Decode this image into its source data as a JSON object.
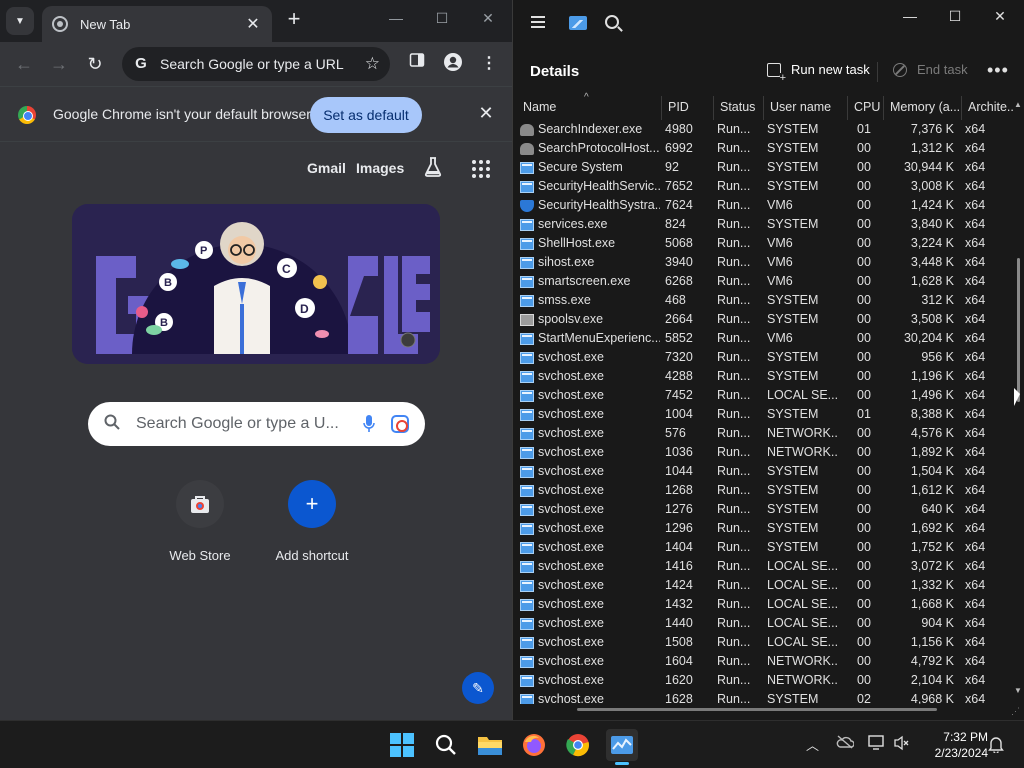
{
  "chrome": {
    "tab_title": "New Tab",
    "tab_close": "✕",
    "new_tab": "+",
    "window_min": "—",
    "window_max": "☐",
    "window_close": "✕",
    "omnibox_placeholder": "Search Google or type a URL",
    "omnibox_g": "G",
    "infobar_text": "Google Chrome isn't your default browser",
    "set_default_label": "Set as default",
    "infobar_close": "✕",
    "gmail_link": "Gmail",
    "images_link": "Images",
    "ntp_search_placeholder": "Search Google or type a U...",
    "shortcuts": [
      {
        "label": "Web Store"
      },
      {
        "label": "Add shortcut",
        "glyph": "+"
      }
    ],
    "edit_glyph": "✎"
  },
  "taskmanager": {
    "heading": "Details",
    "run_new_task": "Run new task",
    "end_task": "End task",
    "more": "•••",
    "window_min": "—",
    "window_max": "☐",
    "window_close": "✕",
    "columns": [
      "Name",
      "PID",
      "Status",
      "User name",
      "CPU",
      "Memory (a...",
      "Archite..."
    ],
    "rows": [
      {
        "icon": "search",
        "name": "SearchIndexer.exe",
        "pid": "4980",
        "status": "Run...",
        "user": "SYSTEM",
        "cpu": "01",
        "mem": "7,376 K",
        "arch": "x64"
      },
      {
        "icon": "search",
        "name": "SearchProtocolHost....",
        "pid": "6992",
        "status": "Run...",
        "user": "SYSTEM",
        "cpu": "00",
        "mem": "1,312 K",
        "arch": "x64"
      },
      {
        "icon": "exe",
        "name": "Secure System",
        "pid": "92",
        "status": "Run...",
        "user": "SYSTEM",
        "cpu": "00",
        "mem": "30,944 K",
        "arch": "x64"
      },
      {
        "icon": "exe",
        "name": "SecurityHealthServic...",
        "pid": "7652",
        "status": "Run...",
        "user": "SYSTEM",
        "cpu": "00",
        "mem": "3,008 K",
        "arch": "x64"
      },
      {
        "icon": "shield",
        "name": "SecurityHealthSystra...",
        "pid": "7624",
        "status": "Run...",
        "user": "VM6",
        "cpu": "00",
        "mem": "1,424 K",
        "arch": "x64"
      },
      {
        "icon": "exe",
        "name": "services.exe",
        "pid": "824",
        "status": "Run...",
        "user": "SYSTEM",
        "cpu": "00",
        "mem": "3,840 K",
        "arch": "x64"
      },
      {
        "icon": "exe",
        "name": "ShellHost.exe",
        "pid": "5068",
        "status": "Run...",
        "user": "VM6",
        "cpu": "00",
        "mem": "3,224 K",
        "arch": "x64"
      },
      {
        "icon": "exe",
        "name": "sihost.exe",
        "pid": "3940",
        "status": "Run...",
        "user": "VM6",
        "cpu": "00",
        "mem": "3,448 K",
        "arch": "x64"
      },
      {
        "icon": "exe",
        "name": "smartscreen.exe",
        "pid": "6268",
        "status": "Run...",
        "user": "VM6",
        "cpu": "00",
        "mem": "1,628 K",
        "arch": "x64"
      },
      {
        "icon": "exe",
        "name": "smss.exe",
        "pid": "468",
        "status": "Run...",
        "user": "SYSTEM",
        "cpu": "00",
        "mem": "312 K",
        "arch": "x64"
      },
      {
        "icon": "print",
        "name": "spoolsv.exe",
        "pid": "2664",
        "status": "Run...",
        "user": "SYSTEM",
        "cpu": "00",
        "mem": "3,508 K",
        "arch": "x64"
      },
      {
        "icon": "exe",
        "name": "StartMenuExperienc...",
        "pid": "5852",
        "status": "Run...",
        "user": "VM6",
        "cpu": "00",
        "mem": "30,204 K",
        "arch": "x64"
      },
      {
        "icon": "exe",
        "name": "svchost.exe",
        "pid": "7320",
        "status": "Run...",
        "user": "SYSTEM",
        "cpu": "00",
        "mem": "956 K",
        "arch": "x64"
      },
      {
        "icon": "exe",
        "name": "svchost.exe",
        "pid": "4288",
        "status": "Run...",
        "user": "SYSTEM",
        "cpu": "00",
        "mem": "1,196 K",
        "arch": "x64"
      },
      {
        "icon": "exe",
        "name": "svchost.exe",
        "pid": "7452",
        "status": "Run...",
        "user": "LOCAL SE...",
        "cpu": "00",
        "mem": "1,496 K",
        "arch": "x64"
      },
      {
        "icon": "exe",
        "name": "svchost.exe",
        "pid": "1004",
        "status": "Run...",
        "user": "SYSTEM",
        "cpu": "01",
        "mem": "8,388 K",
        "arch": "x64"
      },
      {
        "icon": "exe",
        "name": "svchost.exe",
        "pid": "576",
        "status": "Run...",
        "user": "NETWORK...",
        "cpu": "00",
        "mem": "4,576 K",
        "arch": "x64"
      },
      {
        "icon": "exe",
        "name": "svchost.exe",
        "pid": "1036",
        "status": "Run...",
        "user": "NETWORK...",
        "cpu": "00",
        "mem": "1,892 K",
        "arch": "x64"
      },
      {
        "icon": "exe",
        "name": "svchost.exe",
        "pid": "1044",
        "status": "Run...",
        "user": "SYSTEM",
        "cpu": "00",
        "mem": "1,504 K",
        "arch": "x64"
      },
      {
        "icon": "exe",
        "name": "svchost.exe",
        "pid": "1268",
        "status": "Run...",
        "user": "SYSTEM",
        "cpu": "00",
        "mem": "1,612 K",
        "arch": "x64"
      },
      {
        "icon": "exe",
        "name": "svchost.exe",
        "pid": "1276",
        "status": "Run...",
        "user": "SYSTEM",
        "cpu": "00",
        "mem": "640 K",
        "arch": "x64"
      },
      {
        "icon": "exe",
        "name": "svchost.exe",
        "pid": "1296",
        "status": "Run...",
        "user": "SYSTEM",
        "cpu": "00",
        "mem": "1,692 K",
        "arch": "x64"
      },
      {
        "icon": "exe",
        "name": "svchost.exe",
        "pid": "1404",
        "status": "Run...",
        "user": "SYSTEM",
        "cpu": "00",
        "mem": "1,752 K",
        "arch": "x64"
      },
      {
        "icon": "exe",
        "name": "svchost.exe",
        "pid": "1416",
        "status": "Run...",
        "user": "LOCAL SE...",
        "cpu": "00",
        "mem": "3,072 K",
        "arch": "x64"
      },
      {
        "icon": "exe",
        "name": "svchost.exe",
        "pid": "1424",
        "status": "Run...",
        "user": "LOCAL SE...",
        "cpu": "00",
        "mem": "1,332 K",
        "arch": "x64"
      },
      {
        "icon": "exe",
        "name": "svchost.exe",
        "pid": "1432",
        "status": "Run...",
        "user": "LOCAL SE...",
        "cpu": "00",
        "mem": "1,668 K",
        "arch": "x64"
      },
      {
        "icon": "exe",
        "name": "svchost.exe",
        "pid": "1440",
        "status": "Run...",
        "user": "LOCAL SE...",
        "cpu": "00",
        "mem": "904 K",
        "arch": "x64"
      },
      {
        "icon": "exe",
        "name": "svchost.exe",
        "pid": "1508",
        "status": "Run...",
        "user": "LOCAL SE...",
        "cpu": "00",
        "mem": "1,156 K",
        "arch": "x64"
      },
      {
        "icon": "exe",
        "name": "svchost.exe",
        "pid": "1604",
        "status": "Run...",
        "user": "NETWORK...",
        "cpu": "00",
        "mem": "4,792 K",
        "arch": "x64"
      },
      {
        "icon": "exe",
        "name": "svchost.exe",
        "pid": "1620",
        "status": "Run...",
        "user": "NETWORK...",
        "cpu": "00",
        "mem": "2,104 K",
        "arch": "x64"
      },
      {
        "icon": "exe",
        "name": "svchost.exe",
        "pid": "1628",
        "status": "Run...",
        "user": "SYSTEM",
        "cpu": "02",
        "mem": "4,968 K",
        "arch": "x64"
      }
    ]
  },
  "taskbar": {
    "time": "7:32 PM",
    "date": "2/23/2024"
  },
  "colors": {
    "chrome_bg": "#35363a",
    "tm_bg": "#191919",
    "accent": "#4cc2ff",
    "default_button": "#a8c7fa"
  }
}
